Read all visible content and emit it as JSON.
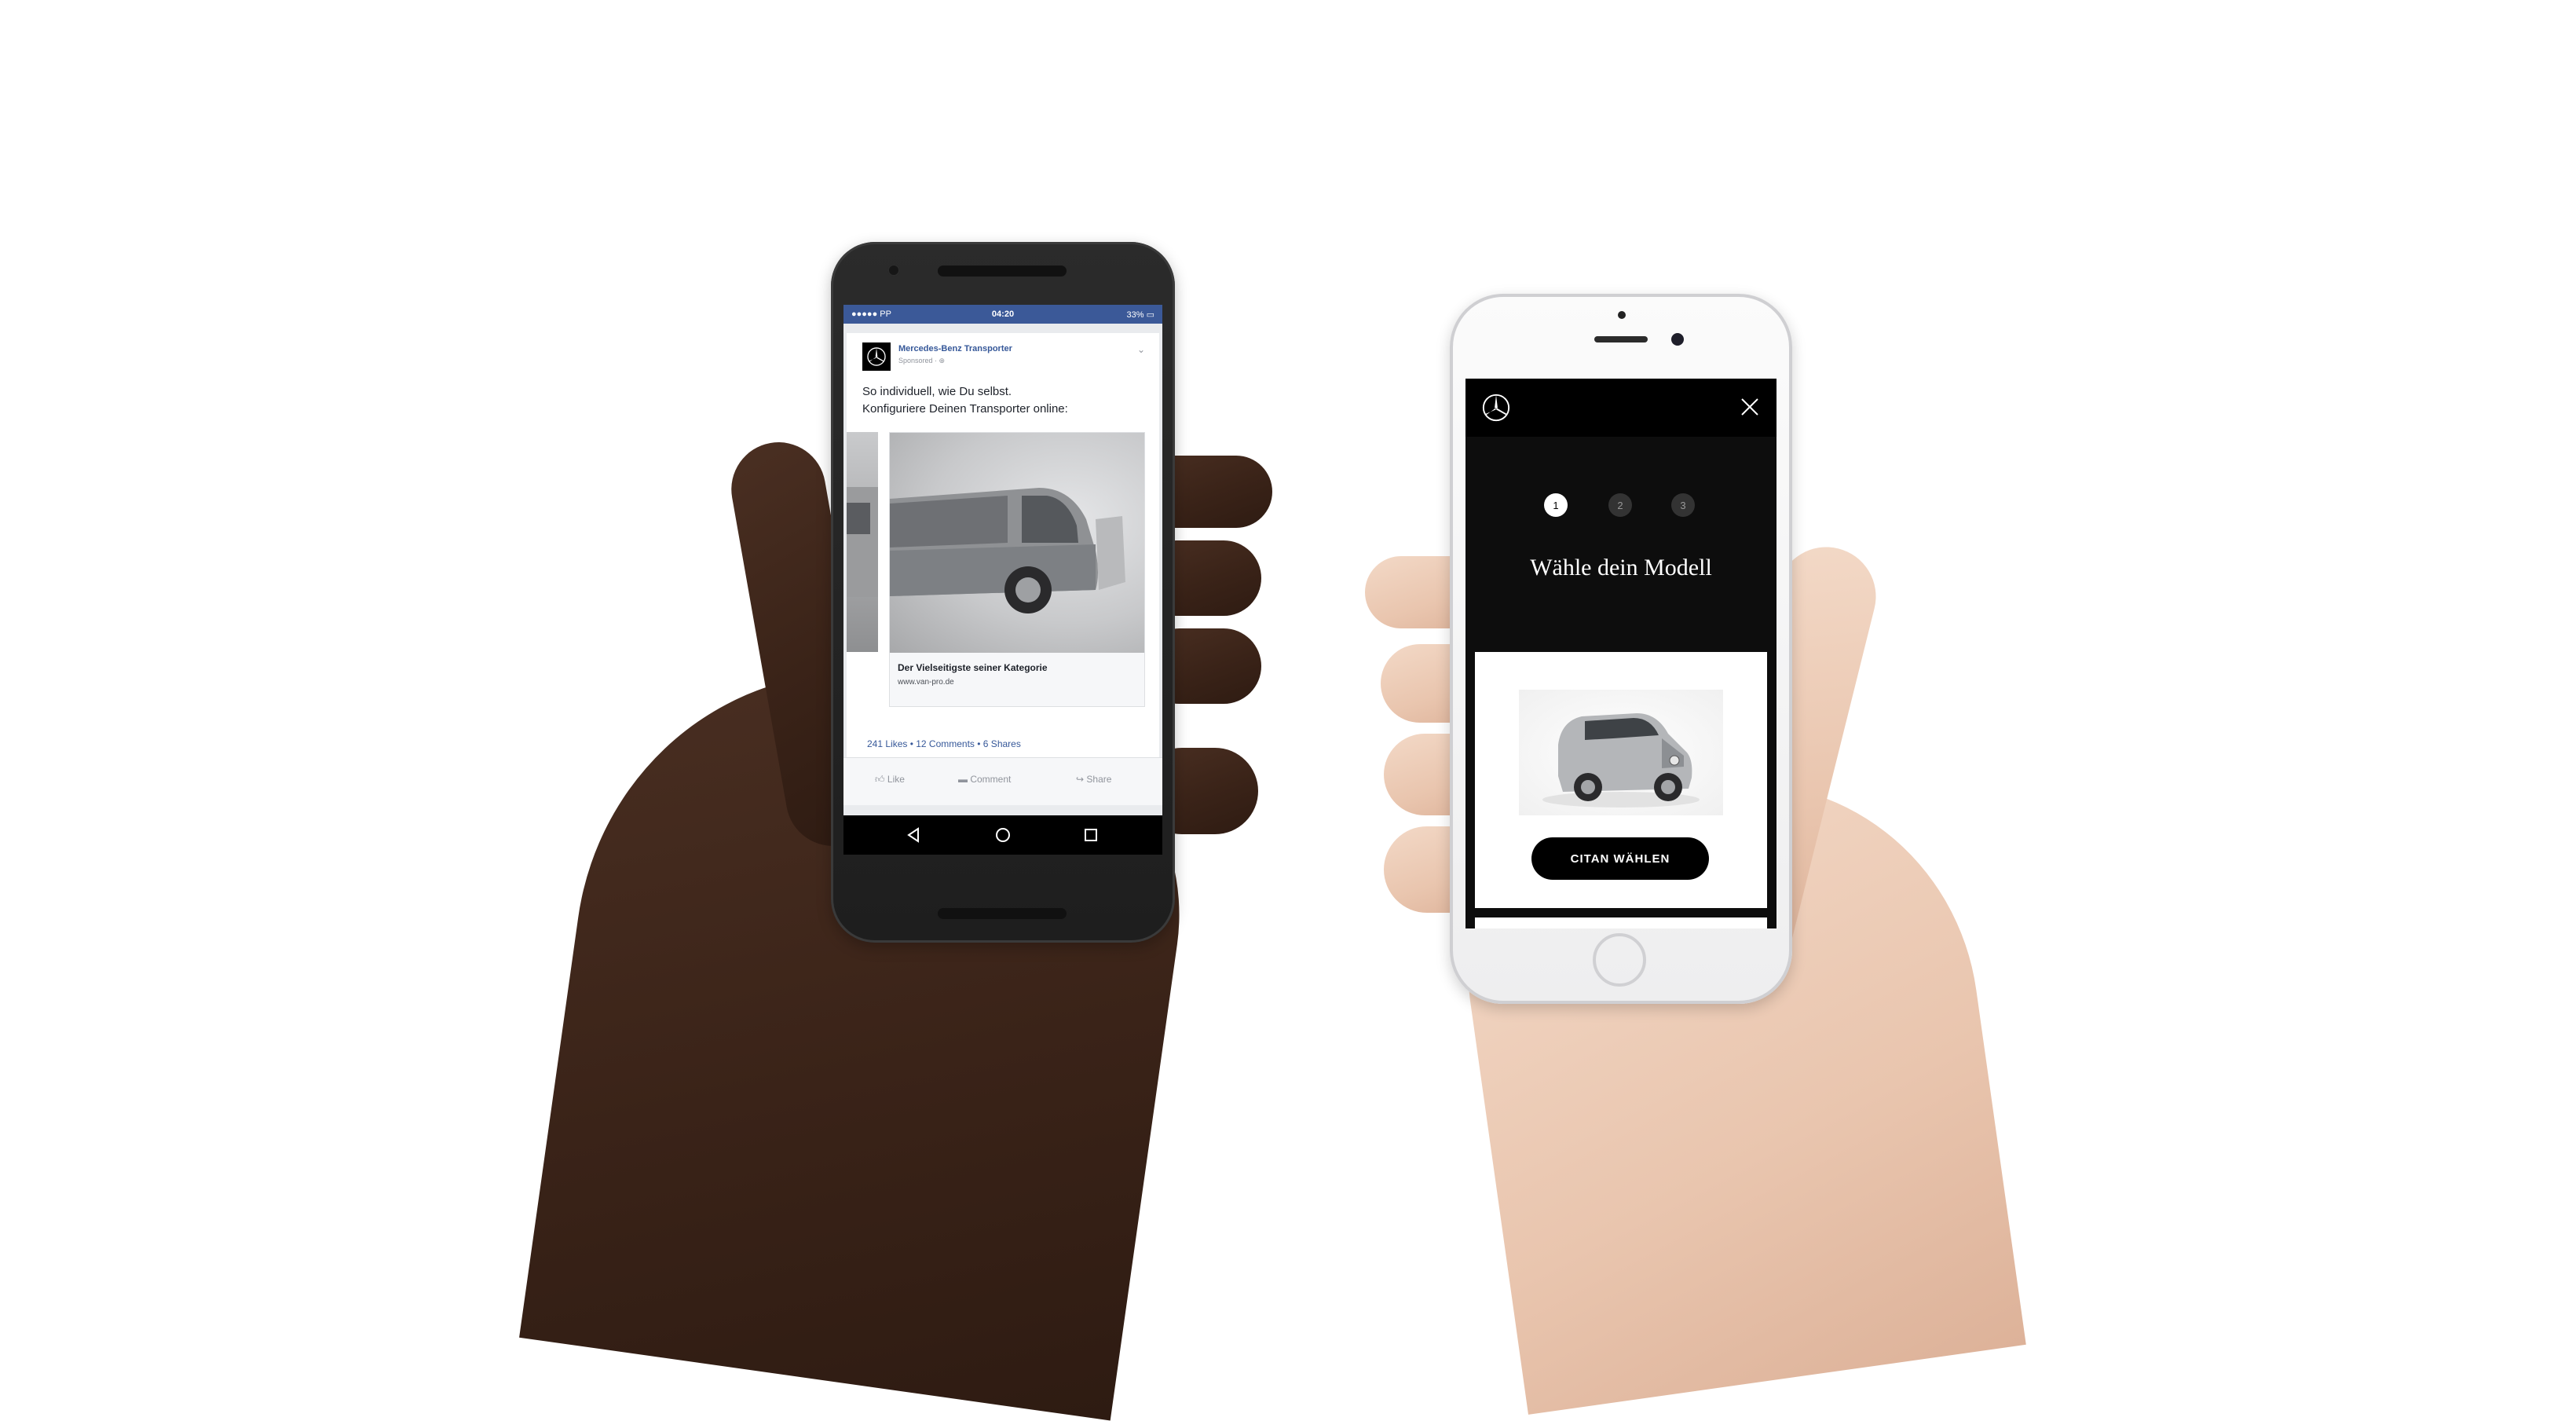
{
  "android_phone": {
    "status_bar": {
      "carrier": "●●●●● PP",
      "time": "04:20",
      "battery": "33%"
    },
    "post": {
      "page_name": "Mercedes-Benz Transporter",
      "sponsored_label": "Sponsored · ",
      "text_line1": "So individuell, wie Du selbst.",
      "text_line2": "Konfiguriere Deinen Transporter online:",
      "carousel_caption": "Der Vielseitigste seiner Kategorie",
      "carousel_url": "www.van-pro.de",
      "stats": "241 Likes • 12 Comments • 6 Shares",
      "actions": {
        "like": "Like",
        "comment": "Comment",
        "share": "Share"
      }
    },
    "icons": [
      "mercedes-star-icon",
      "chevron-down-icon",
      "like-icon",
      "comment-icon",
      "share-icon",
      "back-icon",
      "home-icon",
      "recents-icon"
    ],
    "colors": {
      "facebook_blue": "#3b5998",
      "link_blue": "#365899"
    }
  },
  "iphone": {
    "steps": [
      "1",
      "2",
      "3"
    ],
    "active_step": 1,
    "title": "Wähle dein Modell",
    "model_button": "CITAN WÄHLEN",
    "icons": [
      "mercedes-star-icon",
      "close-icon"
    ],
    "colors": {
      "background": "#0d0d0d",
      "button": "#000000"
    }
  }
}
